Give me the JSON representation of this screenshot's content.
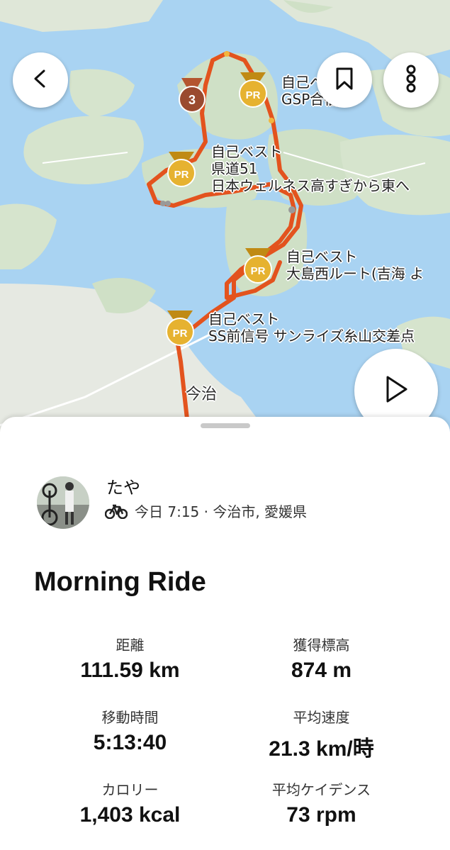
{
  "map": {
    "top_partial_label": "",
    "city_label": "今治",
    "labels": [
      {
        "lines": [
          "自己ベスト",
          "GSP合宿TT"
        ]
      },
      {
        "lines": [
          "自己ベスト",
          "県道51",
          "日本ウェルネス高すぎから東へ"
        ]
      },
      {
        "lines": [
          "自己ベスト",
          "大島西ルート(吉海 よ"
        ]
      },
      {
        "lines": [
          "自己ベスト",
          "SS前信号 サンライズ糸山交差点"
        ]
      }
    ],
    "badges": {
      "pr": "PR",
      "rank": "3"
    },
    "route_color": "#e3531e"
  },
  "toolbar": {
    "back_icon": "chevron-left-icon",
    "bookmark_icon": "bookmark-icon",
    "more_icon": "more-vertical-icon",
    "play_icon": "play-icon"
  },
  "activity": {
    "athlete": "たや",
    "meta": "今日 7:15 · 今治市, 愛媛県",
    "activity_icon": "bike-icon",
    "title": "Morning Ride"
  },
  "stats": [
    {
      "label": "距離",
      "value": "111.59 km"
    },
    {
      "label": "獲得標高",
      "value": "874 m"
    },
    {
      "label": "移動時間",
      "value": "5:13:40"
    },
    {
      "label": "平均速度",
      "value": "21.3 km/時"
    },
    {
      "label": "カロリー",
      "value": "1,403 kcal"
    },
    {
      "label": "平均ケイデンス",
      "value": "73 rpm"
    }
  ]
}
